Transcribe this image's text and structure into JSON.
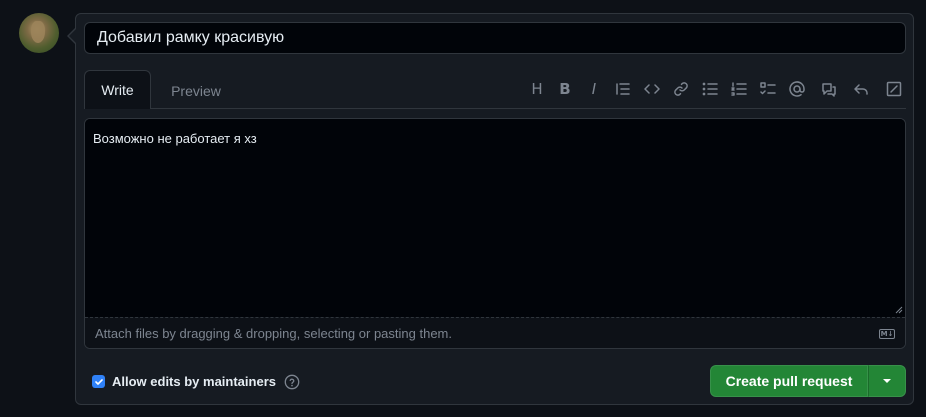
{
  "title_input": {
    "value": "Добавил рамку красивую"
  },
  "tabs": {
    "write": "Write",
    "preview": "Preview"
  },
  "editor": {
    "body": "Возможно не работает я хз",
    "footer_hint": "Attach files by dragging & dropping, selecting or pasting them.",
    "markdown_badge": "M↓"
  },
  "toolbar": {
    "heading": "H",
    "bold": "B",
    "italic": "I"
  },
  "footer": {
    "allow_edits_label": "Allow edits by maintainers",
    "allow_edits_checked": true,
    "create_button": "Create pull request"
  },
  "colors": {
    "primary_button": "#238636",
    "accent": "#2f81f7",
    "background": "#0d1117"
  }
}
